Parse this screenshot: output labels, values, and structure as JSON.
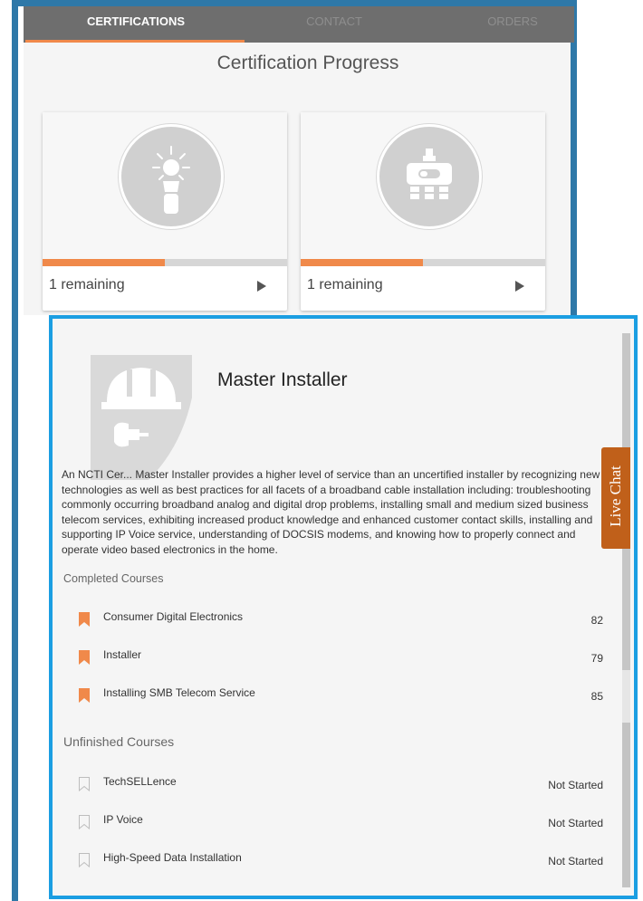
{
  "tabs": [
    {
      "label": "CERTIFICATIONS",
      "active": true
    },
    {
      "label": "CONTACT",
      "active": false
    },
    {
      "label": "ORDERS",
      "active": false
    }
  ],
  "section_title": "Certification Progress",
  "cards": [
    {
      "icon": "lightbulb-icon",
      "remaining": "1 remaining",
      "progress": 0.5
    },
    {
      "icon": "cable-splitter-icon",
      "remaining": "1 remaining",
      "progress": 0.5
    }
  ],
  "detail": {
    "title": "Master Installer",
    "description": "An NCTI Cer... Master Installer provides a higher level of service than an uncertified installer by recognizing new technologies as well as best practices for all facets of a broadband cable installation including: troubleshooting commonly occurring broadband analog and digital drop problems, installing small and medium sized business telecom services, exhibiting increased product knowledge and enhanced customer contact skills, installing and supporting IP Voice service, understanding of DOCSIS modems, and knowing how to properly connect and operate video based electronics in the home.",
    "completed_heading": "Completed Courses",
    "completed": [
      {
        "name": "Consumer Digital Electronics",
        "score": "82"
      },
      {
        "name": "Installer",
        "score": "79"
      },
      {
        "name": "Installing SMB Telecom Service",
        "score": "85"
      }
    ],
    "unfinished_heading": "Unfinished Courses",
    "unfinished": [
      {
        "name": "TechSELLence",
        "status": "Not Started"
      },
      {
        "name": "IP Voice",
        "status": "Not Started"
      },
      {
        "name": "High-Speed Data Installation",
        "status": "Not Started"
      }
    ]
  },
  "live_chat": "Live Chat",
  "colors": {
    "accent": "#f0894a",
    "frame": "#2e78a8",
    "panel_border": "#1b9ee2",
    "live_chat": "#c0601a"
  }
}
